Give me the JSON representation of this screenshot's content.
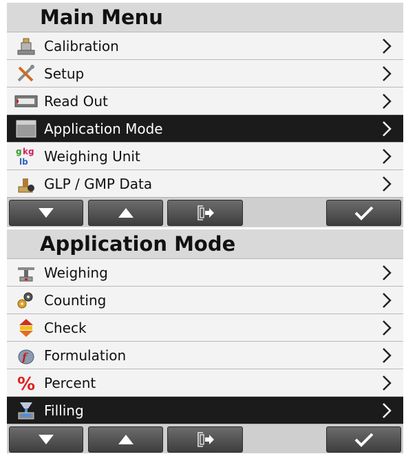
{
  "main_menu": {
    "title": "Main Menu",
    "items": [
      {
        "label": "Calibration",
        "icon": "calibration-icon",
        "selected": false
      },
      {
        "label": "Setup",
        "icon": "setup-tools-icon",
        "selected": false
      },
      {
        "label": "Read Out",
        "icon": "readout-display-icon",
        "selected": false
      },
      {
        "label": "Application Mode",
        "icon": "application-mode-icon",
        "selected": true
      },
      {
        "label": "Weighing Unit",
        "icon": "weighing-unit-icon",
        "selected": false
      },
      {
        "label": "GLP / GMP Data",
        "icon": "glp-gmp-data-icon",
        "selected": false
      }
    ]
  },
  "application_mode": {
    "title": "Application Mode",
    "items": [
      {
        "label": "Weighing",
        "icon": "weighing-icon",
        "selected": false
      },
      {
        "label": "Counting",
        "icon": "counting-icon",
        "selected": false
      },
      {
        "label": "Check",
        "icon": "check-icon",
        "selected": false
      },
      {
        "label": "Formulation",
        "icon": "formulation-icon",
        "selected": false
      },
      {
        "label": "Percent",
        "icon": "percent-icon",
        "selected": false
      },
      {
        "label": "Filling",
        "icon": "filling-icon",
        "selected": true
      }
    ]
  },
  "buttons": {
    "down": "arrow-down-icon",
    "up": "arrow-up-icon",
    "exit": "exit-door-icon",
    "accept": "checkmark-icon"
  },
  "colors": {
    "selected_row": "#1b1b1b",
    "header_bg": "#d9d9d9",
    "button_top": "#6c6c6c",
    "button_bottom": "#3e3e3e"
  }
}
